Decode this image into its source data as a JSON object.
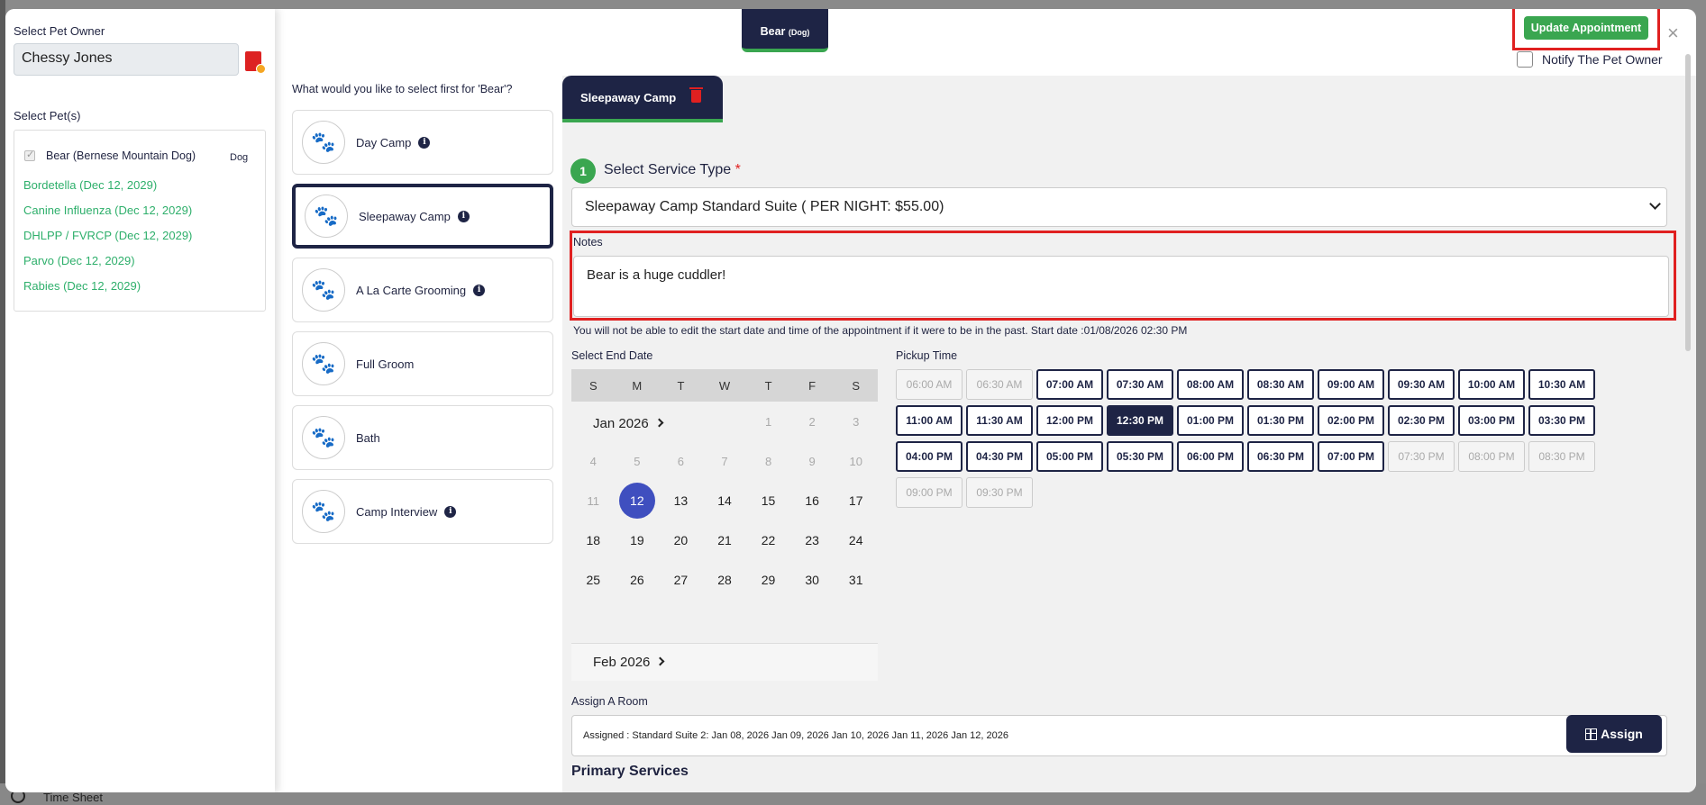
{
  "background": {
    "time_sheet": "Time Sheet"
  },
  "owner": {
    "label": "Select Pet Owner",
    "value": "Chessy Jones"
  },
  "pets": {
    "label": "Select Pet(s)",
    "pet_name": "Bear (Bernese Mountain Dog)",
    "pet_type": "Dog",
    "vaccinations": [
      "Bordetella (Dec 12, 2029)",
      "Canine Influenza (Dec 12, 2029)",
      "DHLPP / FVRCP (Dec 12, 2029)",
      "Parvo (Dec 12, 2029)",
      "Rabies (Dec 12, 2029)"
    ]
  },
  "header": {
    "pet_tab": "Bear",
    "pet_tab_type": "(Dog)",
    "update_button": "Update Appointment",
    "close": "×",
    "notify_label": "Notify The Pet Owner"
  },
  "services": {
    "question": "What would you like to select first for 'Bear'?",
    "items": [
      "Day Camp",
      "Sleepaway Camp",
      "A La Carte Grooming",
      "Full Groom",
      "Bath",
      "Camp Interview"
    ]
  },
  "form": {
    "camp_tab": "Sleepaway Camp",
    "step_number": "1",
    "step_title": "Select Service Type",
    "required_mark": "*",
    "service_type_value": "Sleepaway Camp Standard Suite ( PER NIGHT: $55.00)",
    "notes_label": "Notes",
    "notes_value": "Bear is a huge cuddler!",
    "warning": "You will not be able to edit the start date and time of the appointment if it were to be in the past. Start date :01/08/2026 02:30 PM"
  },
  "calendar": {
    "label": "Select End Date",
    "weekdays": [
      "S",
      "M",
      "T",
      "W",
      "T",
      "F",
      "S"
    ],
    "month": "Jan 2026",
    "next_month": "Feb 2026",
    "selected_day": "12"
  },
  "pickup": {
    "label": "Pickup Time",
    "slots": [
      {
        "t": "06:00 AM",
        "s": "disabled"
      },
      {
        "t": "06:30 AM",
        "s": "disabled"
      },
      {
        "t": "07:00 AM",
        "s": ""
      },
      {
        "t": "07:30 AM",
        "s": ""
      },
      {
        "t": "08:00 AM",
        "s": ""
      },
      {
        "t": "08:30 AM",
        "s": ""
      },
      {
        "t": "09:00 AM",
        "s": ""
      },
      {
        "t": "09:30 AM",
        "s": ""
      },
      {
        "t": "10:00 AM",
        "s": ""
      },
      {
        "t": "10:30 AM",
        "s": ""
      },
      {
        "t": "11:00 AM",
        "s": ""
      },
      {
        "t": "11:30 AM",
        "s": ""
      },
      {
        "t": "12:00 PM",
        "s": ""
      },
      {
        "t": "12:30 PM",
        "s": "selected"
      },
      {
        "t": "01:00 PM",
        "s": ""
      },
      {
        "t": "01:30 PM",
        "s": ""
      },
      {
        "t": "02:00 PM",
        "s": ""
      },
      {
        "t": "02:30 PM",
        "s": ""
      },
      {
        "t": "03:00 PM",
        "s": ""
      },
      {
        "t": "03:30 PM",
        "s": ""
      },
      {
        "t": "04:00 PM",
        "s": ""
      },
      {
        "t": "04:30 PM",
        "s": ""
      },
      {
        "t": "05:00 PM",
        "s": ""
      },
      {
        "t": "05:30 PM",
        "s": ""
      },
      {
        "t": "06:00 PM",
        "s": ""
      },
      {
        "t": "06:30 PM",
        "s": ""
      },
      {
        "t": "07:00 PM",
        "s": ""
      },
      {
        "t": "07:30 PM",
        "s": "disabled"
      },
      {
        "t": "08:00 PM",
        "s": "disabled"
      },
      {
        "t": "08:30 PM",
        "s": "disabled"
      },
      {
        "t": "09:00 PM",
        "s": "disabled"
      },
      {
        "t": "09:30 PM",
        "s": "disabled"
      }
    ]
  },
  "room": {
    "label": "Assign A Room",
    "value": "Assigned :  Standard Suite 2: Jan 08, 2026 Jan 09, 2026 Jan 10, 2026 Jan 11, 2026 Jan 12, 2026",
    "assign_button": "Assign"
  },
  "primary_services_title": "Primary Services",
  "colors": {
    "navy": "#1e2445",
    "green": "#3aa650",
    "red": "#e02020",
    "vacc_green": "#2eaf6b",
    "selected_day": "#3f4fbf"
  }
}
